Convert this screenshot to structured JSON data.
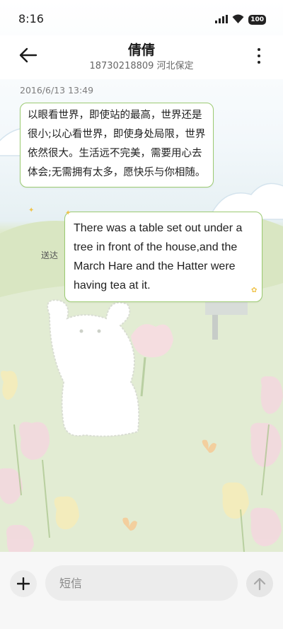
{
  "status_bar": {
    "time": "8:16",
    "battery": "100",
    "icons": [
      "signal-icon",
      "wifi-icon",
      "battery-icon"
    ]
  },
  "header": {
    "contact_name": "倩倩",
    "contact_detail": "18730218809 河北保定",
    "back_icon": "back-arrow-icon",
    "more_icon": "more-vertical-icon"
  },
  "conversation": {
    "timestamp": "2016/6/13 13:49",
    "messages": [
      {
        "direction": "incoming",
        "text": "以眼看世界，即使站的最高，世界还是很小;以心看世界，即使身处局限，世界依然很大。生活远不完美，需要用心去体会;无需拥有太多，愿快乐与你相随。"
      },
      {
        "direction": "outgoing",
        "text": "There was a table set out under a tree in front of the house,and the March Hare and the Hatter were having tea at it.",
        "status": "送达"
      }
    ]
  },
  "composer": {
    "placeholder": "短信",
    "add_icon": "plus-icon",
    "send_icon": "send-arrow-icon"
  },
  "theme": {
    "bubble_border": "#9ccb72",
    "background": "#ffffff"
  }
}
